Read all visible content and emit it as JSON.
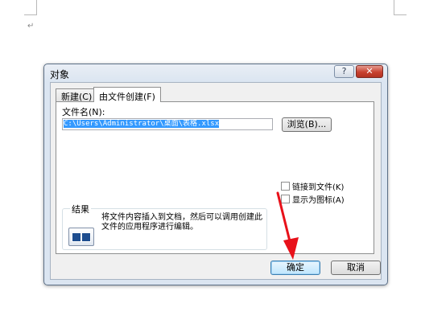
{
  "document": {
    "paragraph_mark": "↵"
  },
  "dialog": {
    "title": "对象",
    "help_glyph": "?",
    "close_glyph": "✕",
    "tabs": [
      {
        "label": "新建(C)",
        "selected": false
      },
      {
        "label": "由文件创建(F)",
        "selected": true
      }
    ],
    "file_name_label": "文件名(N):",
    "file_path_value": "C:\\Users\\Administrator\\桌面\\表格.xlsx",
    "browse_label": "浏览(B)...",
    "checkboxes": [
      {
        "label": "链接到文件(K)",
        "checked": false
      },
      {
        "label": "显示为图标(A)",
        "checked": false
      }
    ],
    "result": {
      "label": "结果",
      "text": "将文件内容插入到文档，然后可以调用创建此文件的应用程序进行编辑。"
    },
    "ok_label": "确定",
    "cancel_label": "取消"
  },
  "colors": {
    "annotation_arrow": "#e8111a",
    "close_button": "#c8412f",
    "selection": "#3399ff"
  }
}
